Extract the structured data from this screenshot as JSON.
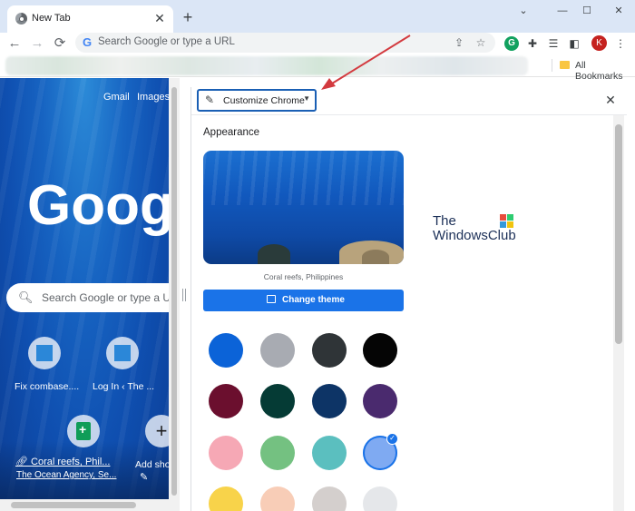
{
  "browser": {
    "tab": {
      "title": "New Tab",
      "close_glyph": "✕"
    },
    "new_tab_glyph": "+",
    "window_controls": {
      "minimize": "—",
      "maximize": "☐",
      "close": "✕",
      "menu": "⌄"
    },
    "nav": {
      "back": "←",
      "forward": "→",
      "reload": "⟳"
    },
    "omnibox": {
      "g_mark": "G",
      "placeholder": "Search Google or type a URL",
      "share_glyph": "⇪",
      "star_glyph": "☆"
    },
    "toolbar_icons": {
      "grammarly": "G",
      "extensions": "✚",
      "reading_list": "☰",
      "side_panel": "◧",
      "avatar_letter": "K",
      "menu": "⋮"
    },
    "bookmarks": {
      "all_bookmarks": "All Bookmarks"
    }
  },
  "ntp": {
    "links": {
      "gmail": "Gmail",
      "images": "Images"
    },
    "logo": "Goog",
    "search_placeholder": "Search Google or type a U",
    "shortcuts": [
      {
        "label": "Fix combase....",
        "icon": "windows-icon"
      },
      {
        "label": "Log In ‹ The ...",
        "icon": "windows-icon"
      },
      {
        "label": "",
        "icon": "sheets-icon"
      },
      {
        "label": "Add sho",
        "icon": "plus-icon"
      }
    ],
    "attribution": {
      "title": "Coral reefs, Phil...",
      "subtitle": "The Ocean Agency, Se..."
    }
  },
  "side_panel": {
    "selector_label": "Customize Chrome",
    "close_glyph": "✕",
    "section_title": "Appearance",
    "theme_caption": "Coral reefs, Philippines",
    "change_theme_label": "Change theme",
    "swatches": [
      {
        "color": "#0b63d8",
        "selected": false
      },
      {
        "color": "#a8abb2",
        "selected": false
      },
      {
        "color": "#2f3437",
        "selected": false
      },
      {
        "color": "#050505",
        "selected": false
      },
      {
        "color": "#6b0f2e",
        "selected": false
      },
      {
        "color": "#053b35",
        "selected": false
      },
      {
        "color": "#0d3466",
        "selected": false
      },
      {
        "color": "#4a2a6e",
        "selected": false
      },
      {
        "color": "#f6a8b5",
        "selected": false
      },
      {
        "color": "#74c181",
        "selected": false
      },
      {
        "color": "#5bbfbf",
        "selected": false
      },
      {
        "color": "#7faaf2",
        "selected": true
      },
      {
        "color": "#f8d34a",
        "selected": false
      },
      {
        "color": "#f8cdb7",
        "selected": false
      },
      {
        "color": "#d4cfcd",
        "selected": false
      },
      {
        "color": "#e5e7ea",
        "selected": false
      }
    ]
  },
  "watermark": {
    "line1": "The",
    "line2": "WindowsClub"
  },
  "colors": {
    "accent": "#1a73e8",
    "annotation_arrow": "#d33a3f",
    "selector_border": "#1a5fb4"
  }
}
